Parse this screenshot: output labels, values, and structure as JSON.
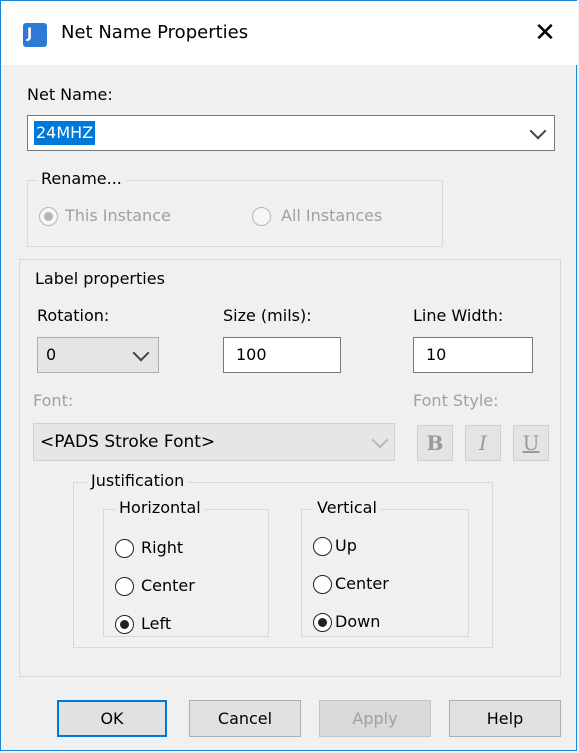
{
  "window": {
    "title": "Net Name Properties",
    "close_glyph": "✕"
  },
  "net_name": {
    "label": "Net Name:",
    "value": "24MHZ"
  },
  "rename": {
    "title": "Rename...",
    "options": [
      "This Instance",
      "All Instances"
    ],
    "selected": "This Instance"
  },
  "label_properties": {
    "title": "Label properties",
    "rotation_label": "Rotation:",
    "rotation_value": "0",
    "size_label": "Size (mils):",
    "size_value": "100",
    "line_width_label": "Line Width:",
    "line_width_value": "10",
    "font_label": "Font:",
    "font_value": "<PADS Stroke Font>",
    "font_style_label": "Font Style:",
    "font_style_buttons": [
      "B",
      "I",
      "U"
    ]
  },
  "justification": {
    "title": "Justification",
    "horizontal": {
      "title": "Horizontal",
      "options": [
        "Right",
        "Center",
        "Left"
      ],
      "selected": "Left"
    },
    "vertical": {
      "title": "Vertical",
      "options": [
        "Up",
        "Center",
        "Down"
      ],
      "selected": "Down"
    }
  },
  "buttons": {
    "ok": "OK",
    "cancel": "Cancel",
    "apply": "Apply",
    "help": "Help"
  },
  "colors": {
    "accent": "#0078d7",
    "selection": "#0078d7",
    "disabled_text": "#a0a0a0"
  }
}
